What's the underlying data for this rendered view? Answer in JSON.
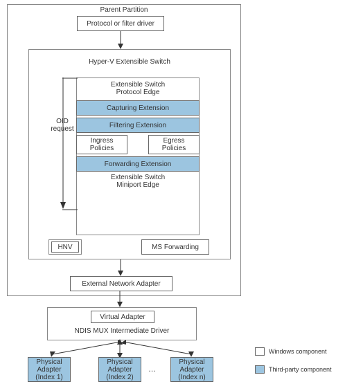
{
  "parent_partition": {
    "title": "Parent Partition",
    "protocol_driver": "Protocol or filter driver",
    "switch_title": "Hyper-V Extensible Switch",
    "protocol_edge": "Extensible Switch\nProtocol Edge",
    "capturing": "Capturing Extension",
    "filtering": "Filtering Extension",
    "ingress": "Ingress\nPolicies",
    "egress": "Egress\nPolicies",
    "forwarding": "Forwarding Extension",
    "miniport_edge": "Extensible Switch\nMiniport Edge",
    "oid_request": "OID\nrequest",
    "hnv": "HNV",
    "ms_forwarding": "MS Forwarding",
    "external_adapter": "External Network Adapter"
  },
  "mux": {
    "virtual_adapter": "Virtual Adapter",
    "driver": "NDIS MUX Intermediate Driver"
  },
  "adapters": [
    {
      "label": "Physical\nAdapter\n(Index 1)"
    },
    {
      "label": "Physical\nAdapter\n(Index 2)"
    },
    {
      "label": "Physical\nAdapter\n(Index n)"
    }
  ],
  "legend": {
    "windows": "Windows component",
    "thirdparty": "Third-party component"
  },
  "colors": {
    "thirdparty_fill": "#9cc5e0",
    "border": "#666666"
  }
}
